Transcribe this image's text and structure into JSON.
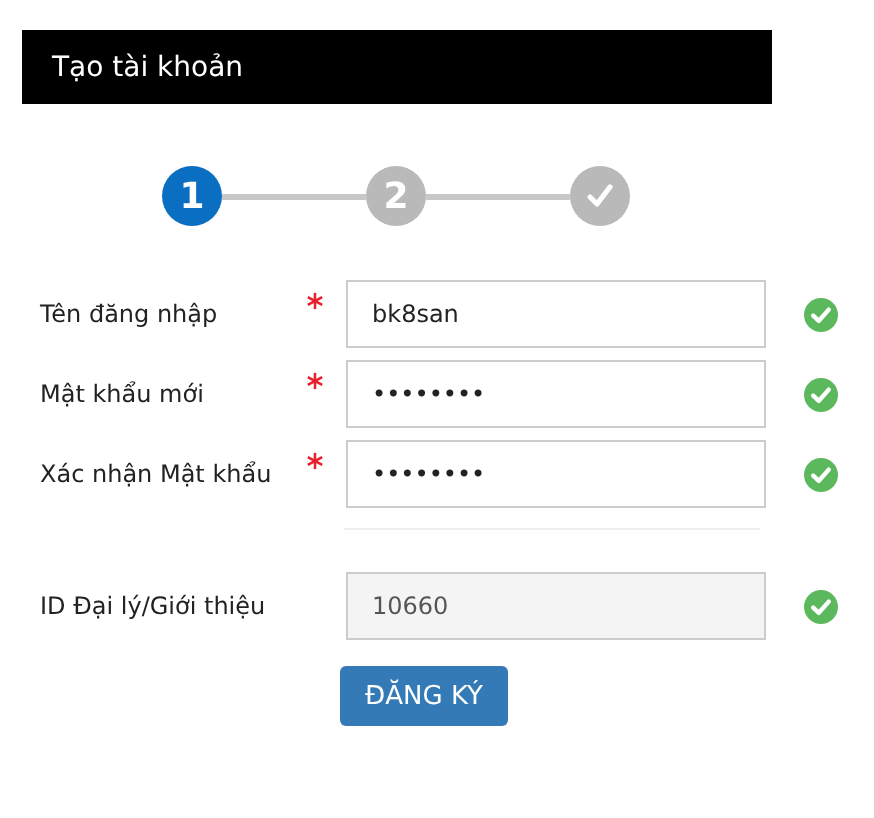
{
  "header": {
    "title": "Tạo tài khoản"
  },
  "steps": [
    {
      "kind": "number",
      "label": "1",
      "active": true
    },
    {
      "kind": "number",
      "label": "2",
      "active": false
    },
    {
      "kind": "check",
      "active": false
    }
  ],
  "fields": [
    {
      "label": "Tên đăng nhập",
      "required": true,
      "value": "bk8san",
      "disabled": false,
      "valid": true,
      "divider_after": false
    },
    {
      "label": "Mật khẩu mới",
      "required": true,
      "value": "••••••••",
      "disabled": false,
      "valid": true,
      "divider_after": false
    },
    {
      "label": "Xác nhận Mật khẩu",
      "required": true,
      "value": "••••••••",
      "disabled": false,
      "valid": true,
      "divider_after": true
    },
    {
      "label": "ID Đại lý/Giới thiệu",
      "required": false,
      "value": "10660",
      "disabled": true,
      "valid": true,
      "divider_after": false
    }
  ],
  "submit_button": {
    "label": "ĐĂNG KÝ"
  }
}
